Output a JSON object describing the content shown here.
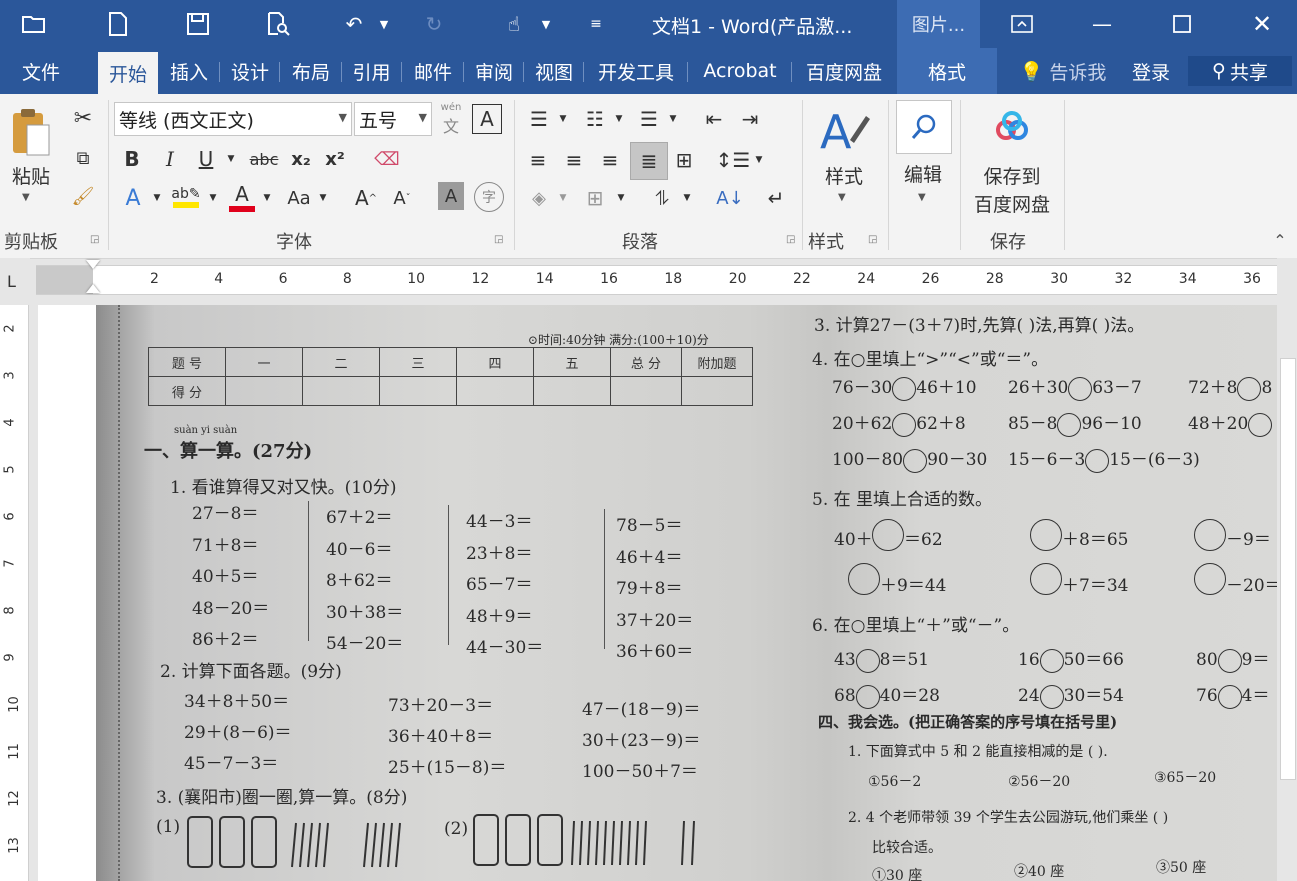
{
  "title": "文档1 - Word(产品激...",
  "context_tab_title": "图片...",
  "tabs": [
    "文件",
    "开始",
    "插入",
    "设计",
    "布局",
    "引用",
    "邮件",
    "审阅",
    "视图",
    "开发工具",
    "Acrobat",
    "百度网盘"
  ],
  "format_tab": "格式",
  "tell_me": "告诉我",
  "login": "登录",
  "share": "共享",
  "ribbon": {
    "clipboard": {
      "paste": "粘贴",
      "label": "剪贴板"
    },
    "font": {
      "name": "等线 (西文正文)",
      "size": "五号",
      "label": "字体",
      "phonetic": "wén",
      "bold": "B",
      "italic": "I",
      "underline": "U",
      "strike": "abc",
      "sub": "x₂",
      "sup": "x²",
      "case": "Aa",
      "enclose": "字"
    },
    "paragraph": {
      "label": "段落"
    },
    "styles": {
      "button": "样式",
      "label": "样式"
    },
    "editing": {
      "button": "编辑"
    },
    "save": {
      "button_line1": "保存到",
      "button_line2": "百度网盘",
      "label": "保存"
    }
  },
  "ruler": {
    "h_numbers": [
      "2",
      "4",
      "6",
      "8",
      "10",
      "12",
      "14",
      "16",
      "18",
      "20",
      "22",
      "24",
      "26",
      "28",
      "30",
      "32",
      "34",
      "36"
    ],
    "v_numbers": [
      "2",
      "3",
      "4",
      "5",
      "6",
      "7",
      "8",
      "9",
      "10",
      "11",
      "12",
      "13"
    ]
  },
  "doc": {
    "time_info": "⊙时间:40分钟  满分:(100＋10)分",
    "table_row1": [
      "题 号",
      "一",
      "二",
      "三",
      "四",
      "五",
      "总 分",
      "附加题"
    ],
    "table_row2": [
      "得 分"
    ],
    "pinyin": "suàn yi suàn",
    "sec1": "一、算一算。(27分)",
    "q1": "1. 看谁算得又对又快。(10分)",
    "col1": [
      "27－8＝",
      "71＋8＝",
      "40＋5＝",
      "48－20＝",
      "86＋2＝"
    ],
    "col2": [
      "67＋2＝",
      "40－6＝",
      "8＋62＝",
      "30＋38＝",
      "54－20＝"
    ],
    "col3": [
      "44－3＝",
      "23＋8＝",
      "65－7＝",
      "48＋9＝",
      "44－30＝"
    ],
    "col4": [
      "78－5＝",
      "46＋4＝",
      "79＋8＝",
      "37＋20＝",
      "36＋60＝"
    ],
    "q2": "2. 计算下面各题。(9分)",
    "q2c1": [
      "34＋8＋50＝",
      "29＋(8－6)＝",
      "45－7－3＝"
    ],
    "q2c2": [
      "73＋20－3＝",
      "36＋40＋8＝",
      "25＋(15－8)＝"
    ],
    "q2c3": [
      "47－(18－9)＝",
      "30＋(23－9)＝",
      "100－50＋7＝"
    ],
    "q3": "3. (襄阳市)圈一圈,算一算。(8分)",
    "q3a": "(1)",
    "q3b": "(2)",
    "r3": "3. 计算27－(3＋7)时,先算(      )法,再算(      )法。",
    "r4": "4. 在○里填上“>”“<”或“＝”。",
    "r4rows": [
      [
        "76－30",
        "46＋10",
        "26＋30",
        "63－7",
        "72＋8",
        "8"
      ],
      [
        "20＋62",
        "62＋8",
        "85－8",
        "96－10",
        "48＋20",
        ""
      ],
      [
        "100－80",
        "90－30",
        "15－6－3",
        "15－(6－3)",
        "",
        ""
      ]
    ],
    "r5": "5. 在   里填上合适的数。",
    "r5rows": [
      [
        "40＋",
        "＝62",
        "＋8＝65",
        "－9＝"
      ],
      [
        "",
        "＋9＝44",
        "＋7＝34",
        "－20＝"
      ]
    ],
    "r6": "6. 在○里填上“＋”或“－”。",
    "r6rows": [
      [
        "43",
        "8＝51",
        "16",
        "50＝66",
        "80",
        "9＝"
      ],
      [
        "68",
        "40＝28",
        "24",
        "30＝54",
        "76",
        "4＝"
      ]
    ],
    "sec4": "四、我会选。(把正确答案的序号填在括号里)",
    "c1": "1. 下面算式中 5 和 2 能直接相减的是 (      ).",
    "c1opts": [
      "①56－2",
      "②56－20",
      "③65－20"
    ],
    "c2": "2. 4 个老师带领 39 个学生去公园游玩,他们乘坐 (      )",
    "c2b": "比较合适。",
    "c2opts": [
      "①30 座",
      "②40 座",
      "③50 座"
    ]
  }
}
